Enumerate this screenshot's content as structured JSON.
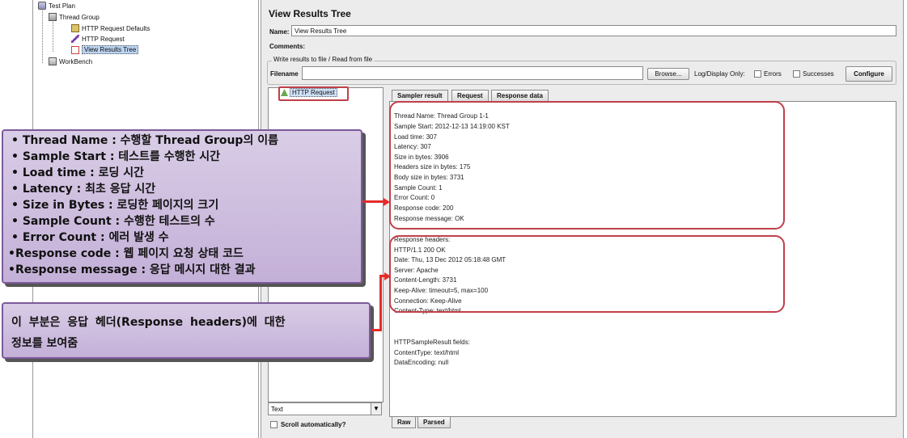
{
  "tree": {
    "nodes": [
      {
        "label": "Test Plan",
        "icon": "test-plan-icon"
      },
      {
        "label": "Thread Group",
        "icon": "thread-group-icon"
      },
      {
        "label": "HTTP Request Defaults",
        "icon": "config-element-icon"
      },
      {
        "label": "HTTP Request",
        "icon": "sampler-icon"
      },
      {
        "label": "View Results Tree",
        "icon": "listener-icon"
      },
      {
        "label": "WorkBench",
        "icon": "workbench-icon"
      }
    ]
  },
  "panel": {
    "title": "View Results Tree",
    "name_label": "Name:",
    "name_value": "View Results Tree",
    "comments_label": "Comments:",
    "file_group_title": "Write results to file / Read from file",
    "filename_label": "Filename",
    "browse_button": "Browse...",
    "log_display_label": "Log/Display Only:",
    "errors_label": "Errors",
    "successes_label": "Successes",
    "configure_button": "Configure"
  },
  "results": {
    "item_label": "HTTP Request",
    "renderer_value": "Text",
    "scroll_label": "Scroll automatically?"
  },
  "tabs": {
    "sampler_result": "Sampler result",
    "request": "Request",
    "response_data": "Response data",
    "raw": "Raw",
    "parsed": "Parsed"
  },
  "sampler_result_lines": [
    "Thread Name: Thread Group 1-1",
    "Sample Start: 2012-12-13 14:19:00 KST",
    "Load time: 307",
    "Latency: 307",
    "Size in bytes: 3906",
    "Headers size in bytes: 175",
    "Body size in bytes: 3731",
    "Sample Count: 1",
    "Error Count: 0",
    "Response code: 200",
    "Response message: OK"
  ],
  "response_header_lines": [
    "Response headers:",
    "HTTP/1.1 200 OK",
    "Date: Thu, 13 Dec 2012 05:18:48 GMT",
    "Server: Apache",
    "Content-Length: 3731",
    "Keep-Alive: timeout=5, max=100",
    "Connection: Keep-Alive",
    "Content-Type: text/html"
  ],
  "result_fields_lines": [
    "HTTPSampleResult fields:",
    "ContentType: text/html",
    "DataEncoding: null"
  ],
  "callout1_lines": [
    "• Thread Name : 수행할 Thread Group의 이름",
    "• Sample Start : 테스트를 수행한 시간",
    "• Load time : 로딩 시간",
    "• Latency :  최초 응답 시간",
    "• Size in Bytes : 로딩한 페이지의 크기",
    "• Sample Count : 수행한 테스트의 수",
    "• Error Count : 에러 발생 수",
    "•Response code : 웹 페이지 요청 상태 코드",
    "•Response message : 응답 메시지 대한 결과"
  ],
  "callout2_lines": [
    "이 부분은 응답 헤더(Response headers)에 대한",
    "정보를 보여줌"
  ]
}
